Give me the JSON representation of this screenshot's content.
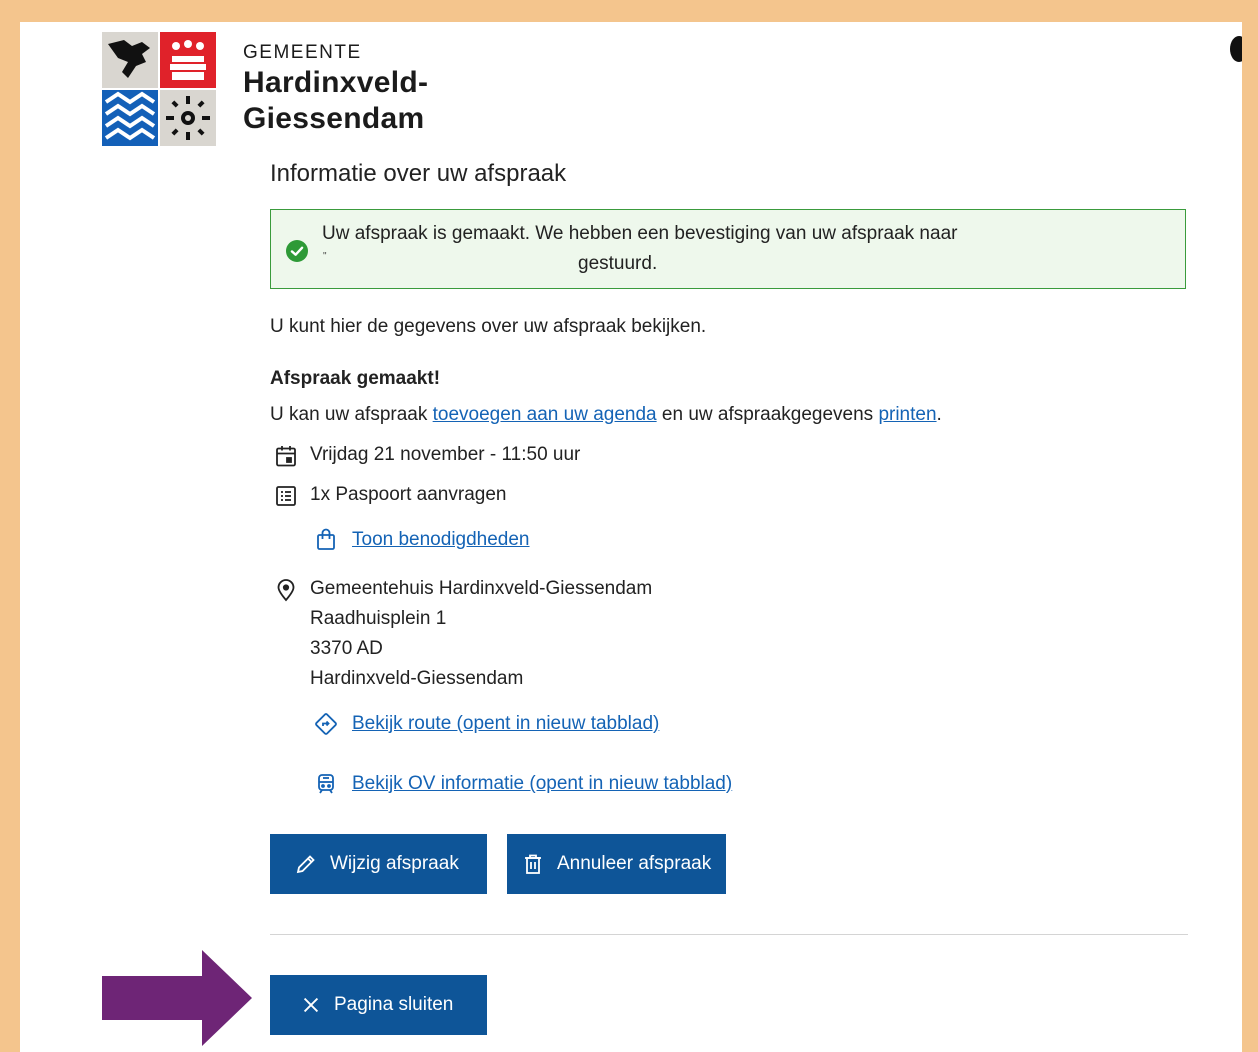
{
  "header": {
    "logo_small": "GEMEENTE",
    "logo_line1": "Hardinxveld-",
    "logo_line2": "Giessendam"
  },
  "page": {
    "title": "Informatie over uw afspraak"
  },
  "alert": {
    "line1": "Uw afspraak is gemaakt. We hebben een bevestiging van uw afspraak naar",
    "mark": "\"",
    "line2": "gestuurd."
  },
  "intro": "U kunt hier de gegevens over uw afspraak bekijken.",
  "section": {
    "heading": "Afspraak gemaakt!",
    "text_before": "U kan uw afspraak ",
    "agenda_link": "toevoegen aan uw agenda",
    "text_middle": " en uw afspraakgegevens ",
    "print_link": "printen",
    "text_after": "."
  },
  "details": {
    "date": "Vrijdag 21 november - 11:50 uur",
    "product": "1x Paspoort aanvragen",
    "requirements_link": "Toon benodigdheden",
    "location_name": "Gemeentehuis Hardinxveld-Giessendam",
    "street": "Raadhuisplein 1",
    "postcode": "3370 AD",
    "city": "Hardinxveld-Giessendam",
    "route_link": "Bekijk route (opent in nieuw tabblad)",
    "ov_link": "Bekijk OV informatie (opent in nieuw tabblad)"
  },
  "buttons": {
    "edit": "Wijzig afspraak",
    "cancel": "Annuleer afspraak",
    "close": "Pagina sluiten"
  },
  "colors": {
    "frame_border": "#f4c58d",
    "primary": "#0e5598",
    "link": "#1463b5",
    "success": "#2e9a37",
    "arrow": "#6e2576"
  }
}
